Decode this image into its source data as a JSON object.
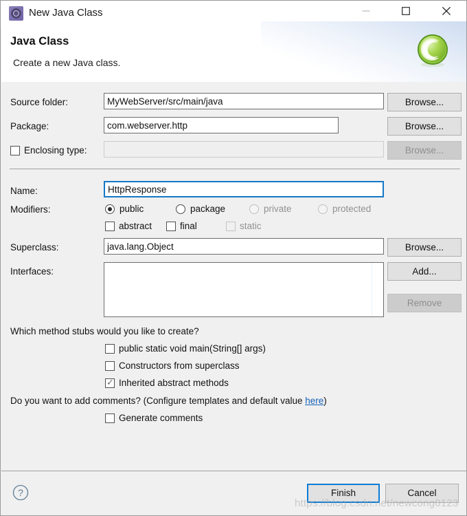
{
  "window": {
    "title": "New Java Class",
    "icon": "java-wizard-icon",
    "controls": {
      "minimize": "minimize-icon",
      "maximize": "maximize-icon",
      "close": "close-icon"
    }
  },
  "banner": {
    "title": "Java Class",
    "subtitle": "Create a new Java class.",
    "logo": "green-class-icon"
  },
  "form": {
    "source_folder": {
      "label": "Source folder:",
      "value": "MyWebServer/src/main/java",
      "button": "Browse..."
    },
    "package": {
      "label": "Package:",
      "value": "com.webserver.http",
      "button": "Browse..."
    },
    "enclosing_type": {
      "label": "Enclosing type:",
      "value": "",
      "checked": false,
      "button": "Browse...",
      "enabled": false
    },
    "name": {
      "label": "Name:",
      "value": "HttpResponse",
      "focused": true
    },
    "modifiers": {
      "label": "Modifiers:",
      "radios": [
        {
          "label": "public",
          "selected": true,
          "enabled": true
        },
        {
          "label": "package",
          "selected": false,
          "enabled": true
        },
        {
          "label": "private",
          "selected": false,
          "enabled": false
        },
        {
          "label": "protected",
          "selected": false,
          "enabled": false
        }
      ],
      "checkboxes": [
        {
          "label": "abstract",
          "checked": false,
          "enabled": true
        },
        {
          "label": "final",
          "checked": false,
          "enabled": true
        },
        {
          "label": "static",
          "checked": false,
          "enabled": false
        }
      ]
    },
    "superclass": {
      "label": "Superclass:",
      "value": "java.lang.Object",
      "button": "Browse..."
    },
    "interfaces": {
      "label": "Interfaces:",
      "items": [],
      "add_button": "Add...",
      "remove_button": "Remove",
      "remove_enabled": false
    },
    "method_stubs": {
      "question": "Which method stubs would you like to create?",
      "options": [
        {
          "label": "public static void main(String[] args)",
          "checked": false
        },
        {
          "label": "Constructors from superclass",
          "checked": false
        },
        {
          "label": "Inherited abstract methods",
          "checked": true
        }
      ]
    },
    "comments": {
      "question_before": "Do you want to add comments? (Configure templates and default value ",
      "link": "here",
      "question_after": ")",
      "option": {
        "label": "Generate comments",
        "checked": false
      }
    }
  },
  "footer": {
    "help": "help-icon",
    "finish_label": "Finish",
    "cancel_label": "Cancel"
  },
  "watermark": "https://blog.csdn.net/newcong0123",
  "colors": {
    "accent": "#0b7bd4",
    "link": "#1560b8",
    "dialog_bg": "#f0f0f0",
    "banner_bg": "#ffffff",
    "logo_green": "#86c232"
  }
}
